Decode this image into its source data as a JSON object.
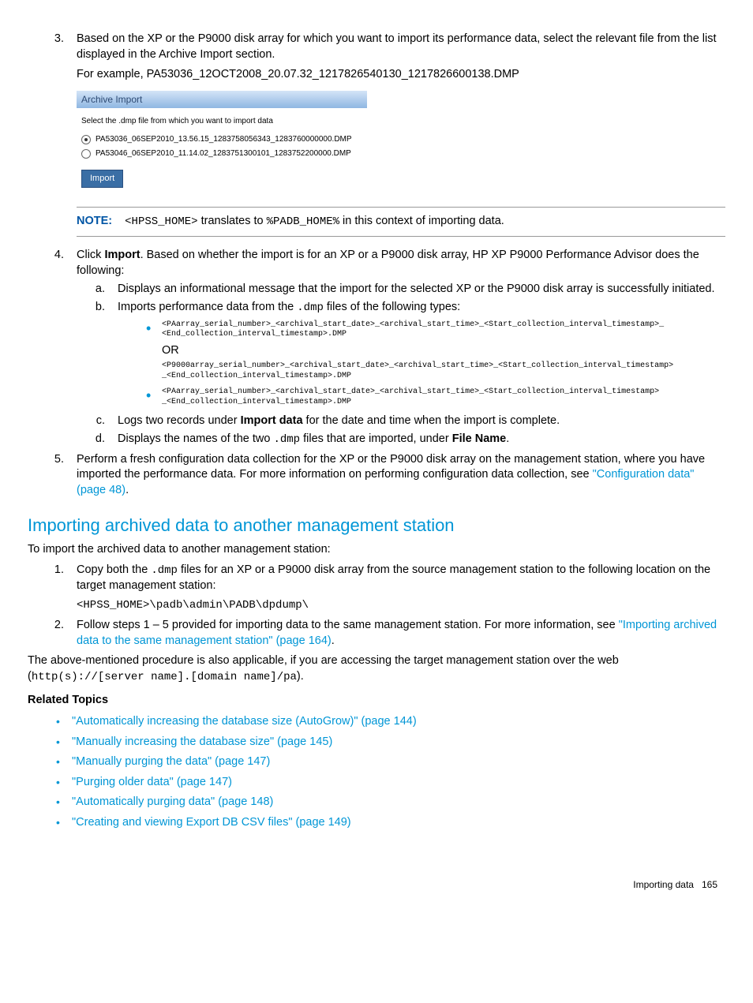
{
  "step3": {
    "text_a": "Based on the XP or the P9000 disk array for which you want to import its performance data, select the relevant file from the list displayed in the Archive Import section.",
    "text_b": "For example, PA53036_12OCT2008_20.07.32_1217826540130_1217826600138.DMP"
  },
  "screenshot": {
    "header": "Archive Import",
    "instruction": "Select the .dmp file from which you want to import data",
    "row1": "PA53036_06SEP2010_13.56.15_1283758056343_1283760000000.DMP",
    "row2": "PA53046_06SEP2010_11.14.02_1283751300101_1283752200000.DMP",
    "button": "Import"
  },
  "note": {
    "label": "NOTE:",
    "pre": "<HPSS_HOME>",
    "mid": " translates to ",
    "code": "%PADB_HOME%",
    "post": " in this context of importing data."
  },
  "step4": {
    "lead_a": "Click ",
    "lead_bold": "Import",
    "lead_b": ". Based on whether the import is for an XP or a P9000 disk array, HP XP P9000 Performance Advisor does the following:",
    "a": "Displays an informational message that the import for the selected XP or the P9000 disk array is successfully initiated.",
    "b_pre": "Imports performance data from the ",
    "b_code": ".dmp",
    "b_post": " files of the following types:",
    "bullet1_l1": "<PAarray_serial_number>_<archival_start_date>_<archival_start_time>_<Start_collection_interval_timestamp>_",
    "bullet1_l2": "<End_collection_interval_timestamp>.DMP",
    "or": "OR",
    "bullet1_l3": "<P9000array_serial_number>_<archival_start_date>_<archival_start_time>_<Start_collection_interval_timestamp>",
    "bullet1_l4": "_<End_collection_interval_timestamp>.DMP",
    "bullet2_l1": "<PAarray_serial_number>_<archival_start_date>_<archival_start_time>_<Start_collection_interval_timestamp>",
    "bullet2_l2": "_<End_collection_interval_timestamp>.DMP",
    "c_pre": "Logs two records under ",
    "c_bold": "Import data",
    "c_post": " for the date and time when the import is complete.",
    "d_pre": "Displays the names of the two ",
    "d_code": ".dmp",
    "d_mid": " files that are imported, under ",
    "d_bold": "File Name",
    "d_post": "."
  },
  "step5": {
    "text_a": "Perform a fresh configuration data collection for the XP or the P9000 disk array on the management station, where you have imported the performance data. For more information on performing configuration data collection, see ",
    "link": "\"Configuration data\" (page 48)",
    "text_b": "."
  },
  "section2": {
    "heading": "Importing archived data to another management station",
    "intro": "To import the archived data to another management station:",
    "s1_pre": "Copy both the ",
    "s1_code": ".dmp",
    "s1_post": " files for an XP or a P9000 disk array from the source management station to the following location on the target management station:",
    "s1_path": "<HPSS_HOME>\\padb\\admin\\PADB\\dpdump\\",
    "s2_pre": "Follow steps 1 – 5 provided for importing data to the same management station. For more information, see ",
    "s2_link": "\"Importing archived data to the same management station\" (page 164)",
    "s2_post": ".",
    "outro_pre": "The above-mentioned procedure is also applicable, if you are accessing the target management station over the web (",
    "outro_code": "http(s)://[server name].[domain name]/pa",
    "outro_post": ")."
  },
  "related": {
    "heading": "Related Topics",
    "items": [
      "\"Automatically increasing the database size (AutoGrow)\" (page 144)",
      "\"Manually increasing the database size\" (page 145)",
      "\"Manually purging the data\" (page 147)",
      "\"Purging older data\" (page 147)",
      "\"Automatically purging data\" (page 148)",
      "\"Creating and viewing Export DB CSV files\" (page 149)"
    ]
  },
  "footer": {
    "section": "Importing data",
    "page": "165"
  }
}
